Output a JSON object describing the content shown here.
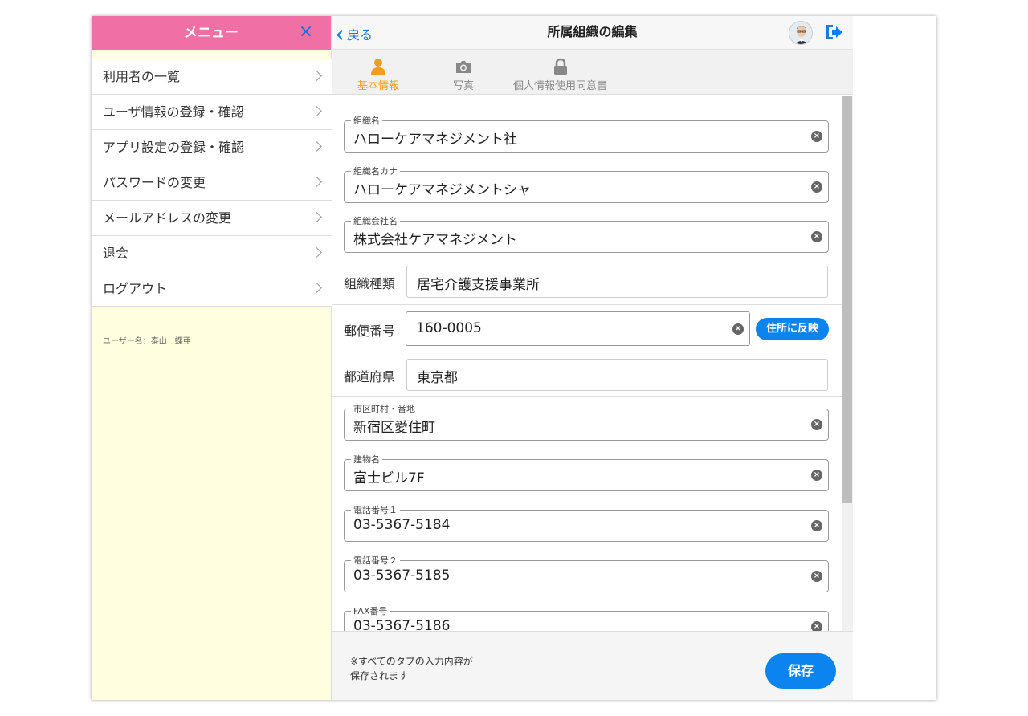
{
  "menu": {
    "title": "メニュー",
    "close_icon": "×",
    "items": [
      {
        "label": "利用者の一覧"
      },
      {
        "label": "ユーザ情報の登録・確認"
      },
      {
        "label": "アプリ設定の登録・確認"
      },
      {
        "label": "パスワードの変更"
      },
      {
        "label": "メールアドレスの変更"
      },
      {
        "label": "退会"
      },
      {
        "label": "ログアウト"
      }
    ],
    "username": "ユーザー名：泰山　蝶亜"
  },
  "header": {
    "back_label": "戻る",
    "title": "所属組織の編集",
    "avatar_icon": "user-avatar",
    "logout_icon": "logout-icon"
  },
  "tabs": [
    {
      "label": "基本情報",
      "icon": "person-icon",
      "active": true
    },
    {
      "label": "写真",
      "icon": "camera-icon",
      "active": false
    },
    {
      "label": "個人情報使用同意書",
      "icon": "lock-icon",
      "active": false
    }
  ],
  "form": {
    "org_name": {
      "label": "組織名",
      "value": "ハローケアマネジメント社"
    },
    "org_kana": {
      "label": "組織名カナ",
      "value": "ハローケアマネジメントシャ"
    },
    "company_name": {
      "label": "組織会社名",
      "value": "株式会社ケアマネジメント"
    },
    "org_type": {
      "label": "組織種類",
      "value": "居宅介護支援事業所"
    },
    "postal": {
      "label": "郵便番号",
      "value": "160-0005",
      "button": "住所に反映"
    },
    "prefecture": {
      "label": "都道府県",
      "value": "東京都"
    },
    "city": {
      "label": "市区町村・番地",
      "value": "新宿区愛住町"
    },
    "building": {
      "label": "建物名",
      "value": "富士ビル7F"
    },
    "phone1": {
      "label": "電話番号１",
      "value": "03-5367-5184"
    },
    "phone2": {
      "label": "電話番号２",
      "value": "03-5367-5185"
    },
    "fax": {
      "label": "FAX番号",
      "value": "03-5367-5186"
    }
  },
  "footer": {
    "note": "※すべてのタブの入力内容が保存されます",
    "save_label": "保存"
  },
  "colors": {
    "menu_header": "#f06fa4",
    "menu_bg": "#ffffe0",
    "accent_blue": "#0b84f0",
    "tab_active": "#f39c1e"
  }
}
